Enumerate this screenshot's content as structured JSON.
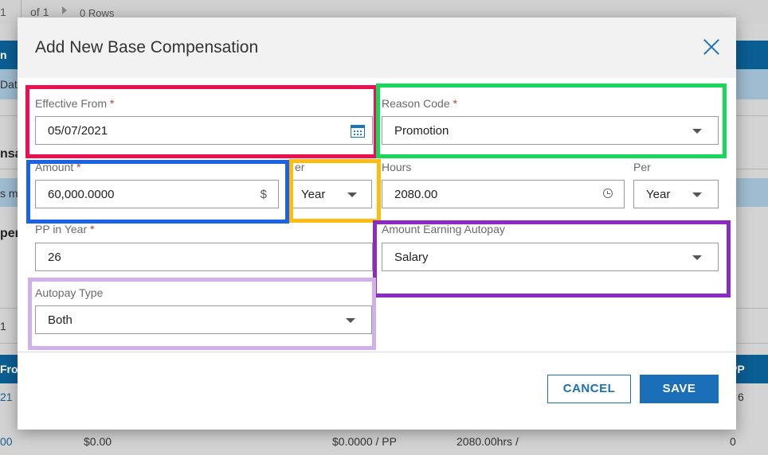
{
  "background": {
    "pager": {
      "page": "1",
      "of": "of 1",
      "rows": "0 Rows"
    },
    "fragments": {
      "header_n": "n",
      "data": "Data",
      "sa": "nsa",
      "sm": "s m",
      "pen": "pen",
      "one": "1",
      "fro": "Fro",
      "pp": "PP",
      "row1_left": "21",
      "row1_right": "6",
      "row2_a": "00",
      "row2_b": "$0.00",
      "row2_c": "$0.0000 / PP",
      "row2_d": "2080.00hrs /",
      "row2_e": "0"
    }
  },
  "modal": {
    "title": "Add New Base Compensation",
    "effective_from": {
      "label": "Effective From",
      "required_mark": "*",
      "value": "05/07/2021",
      "icon": "calendar-icon"
    },
    "reason_code": {
      "label": "Reason Code",
      "required_mark": "*",
      "value": "Promotion"
    },
    "amount": {
      "label": "Amount",
      "required_mark": "*",
      "value": "60,000.0000",
      "suffix": "$"
    },
    "amount_per": {
      "label": "er",
      "value": "Year"
    },
    "hours": {
      "label": "Hours",
      "value": "2080.00",
      "icon": "clock-icon"
    },
    "hours_per": {
      "label": "Per",
      "value": "Year"
    },
    "pp_in_year": {
      "label": "PP in Year",
      "required_mark": "*",
      "value": "26"
    },
    "amount_earning_autopay": {
      "label": "Amount Earning Autopay",
      "value": "Salary"
    },
    "autopay_type": {
      "label": "Autopay Type",
      "value": "Both"
    },
    "buttons": {
      "cancel": "CANCEL",
      "save": "SAVE"
    }
  },
  "colors": {
    "accent": "#1a6fb8",
    "highlight_red": "#ec0f52",
    "highlight_green": "#18d957",
    "highlight_blue": "#1a62e8",
    "highlight_yellow": "#fbbd10",
    "highlight_purple": "#8a2bc4",
    "highlight_lavender": "#d2b0ea"
  }
}
